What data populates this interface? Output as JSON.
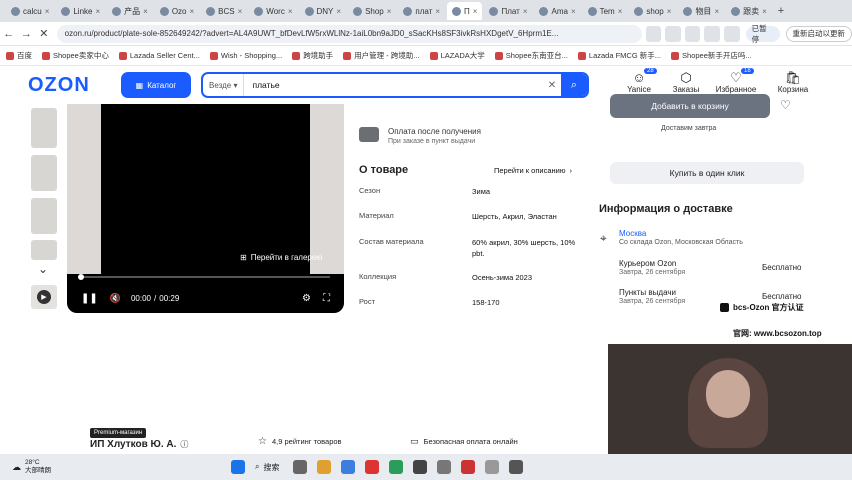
{
  "browser": {
    "tabs": [
      {
        "label": "calcu",
        "active": false
      },
      {
        "label": "Linke",
        "active": false
      },
      {
        "label": "产品",
        "active": false
      },
      {
        "label": "Ozo",
        "active": false
      },
      {
        "label": "BCS",
        "active": false
      },
      {
        "label": "Worc",
        "active": false
      },
      {
        "label": "DNY",
        "active": false
      },
      {
        "label": "Shop",
        "active": false
      },
      {
        "label": "плат",
        "active": false
      },
      {
        "label": "П",
        "active": true
      },
      {
        "label": "Плат",
        "active": false
      },
      {
        "label": "Ama",
        "active": false
      },
      {
        "label": "Tem",
        "active": false
      },
      {
        "label": "shop",
        "active": false
      },
      {
        "label": "物目",
        "active": false
      },
      {
        "label": "跟卖",
        "active": false
      }
    ],
    "url": "ozon.ru/product/plate-sole-852649242/?advert=AL4A9UWT_bfDevLfW5rxWLlNz-1aiL0bn9aJD0_sSacKHs8SF3ivkRsHXDgetV_6Hprm1E...",
    "paused_label": "已暂停",
    "restart_label": "重新启动以更新",
    "bookmarks": [
      {
        "label": "百度"
      },
      {
        "label": "Shopee卖家中心"
      },
      {
        "label": "Lazada Seller Cent..."
      },
      {
        "label": "Wish - Shopping..."
      },
      {
        "label": "跨境助手"
      },
      {
        "label": "用户管理 - 跨境助..."
      },
      {
        "label": "LAZADA大学"
      },
      {
        "label": "Shopee东南亚台..."
      },
      {
        "label": "Lazada FMCG 新手..."
      },
      {
        "label": "Shopee新手开店吗..."
      }
    ]
  },
  "header": {
    "logo": "OZON",
    "catalog_label": "Каталог",
    "scope_label": "Везде",
    "search_value": "платье",
    "icons": [
      {
        "label": "Yanice",
        "icon": "face-icon",
        "badge": "28"
      },
      {
        "label": "Заказы",
        "icon": "box-icon",
        "badge": ""
      },
      {
        "label": "Избранное",
        "icon": "heart-icon",
        "badge": "18"
      },
      {
        "label": "Корзина",
        "icon": "cart-icon",
        "badge": ""
      }
    ]
  },
  "video": {
    "gallery_label": "Перейти в галерею",
    "time_current": "00:00",
    "time_total": "00:29",
    "progress": 0.0
  },
  "payment": {
    "title": "Оплата после получения",
    "subtitle": "При заказе в пункт выдачи"
  },
  "about": {
    "title": "О товаре",
    "link": "Перейти к описанию",
    "specs": [
      {
        "key": "Сезон",
        "value": "Зима"
      },
      {
        "key": "Материал",
        "value": "Шерсть, Акрил, Эластан"
      },
      {
        "key": "Состав материала",
        "value": "60% акрил, 30% шерсть, 10% pbt."
      },
      {
        "key": "Коллекция",
        "value": "Осень-зима 2023"
      },
      {
        "key": "Рост",
        "value": "158-170"
      }
    ]
  },
  "cart": {
    "add_label": "Добавить в корзину",
    "delivery_tomorrow": "Доставим завтра",
    "one_click": "Купить в один клик"
  },
  "delivery": {
    "title": "Информация о доставке",
    "city": "Москва",
    "warehouse": "Со склада Ozon, Московская Область",
    "options": [
      {
        "name": "Курьером Ozon",
        "date": "Завтра, 26 сентября",
        "price": "Бесплатно"
      },
      {
        "name": "Пункты выдачи",
        "date": "Завтра, 26 сентября",
        "price": "Бесплатно"
      }
    ]
  },
  "seller": {
    "premium_label": "Premium-магазин",
    "name": "ИП Хлутков Ю. А.",
    "rating": "4,9 рейтинг товаров",
    "safe_pay": "Безопасная оплата онлайн"
  },
  "watermark": {
    "line1": "bcs-Ozon 官方认证",
    "line2": "官网: www.bcsozon.top"
  },
  "taskbar": {
    "weather_temp": "28°C",
    "weather_desc": "大部晴朗",
    "search_label": "搜索"
  }
}
